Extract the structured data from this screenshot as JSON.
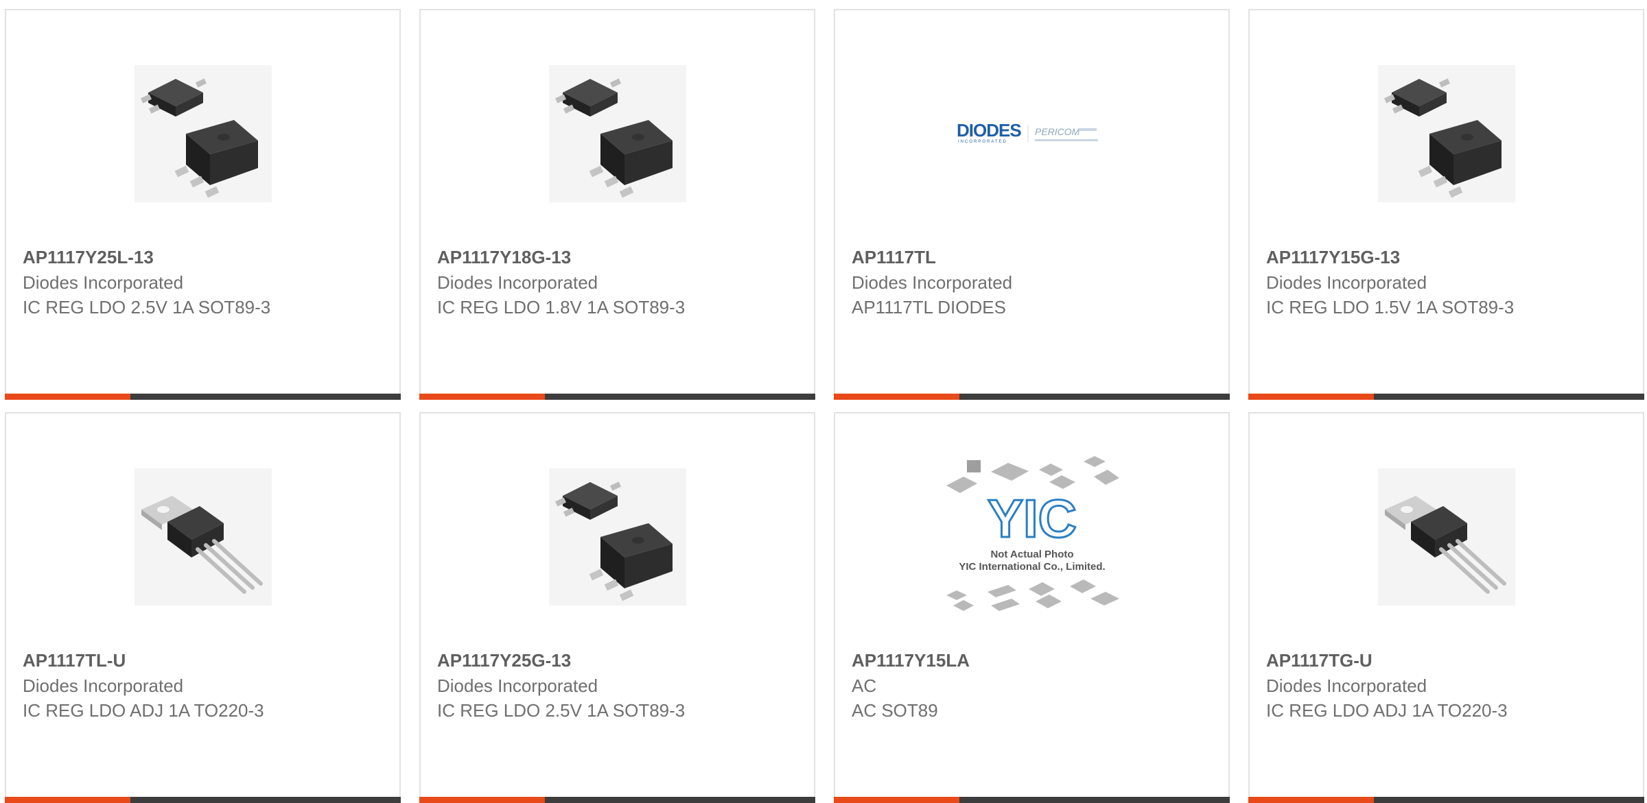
{
  "products": [
    {
      "part": "AP1117Y25L-13",
      "manufacturer": "Diodes Incorporated",
      "description": "IC REG LDO 2.5V 1A SOT89-3",
      "image": "sot89-package-icon"
    },
    {
      "part": "AP1117Y18G-13",
      "manufacturer": "Diodes Incorporated",
      "description": "IC REG LDO 1.8V 1A SOT89-3",
      "image": "sot89-package-icon"
    },
    {
      "part": "AP1117TL",
      "manufacturer": "Diodes Incorporated",
      "description": "AP1117TL DIODES",
      "image": "diodes-logo"
    },
    {
      "part": "AP1117Y15G-13",
      "manufacturer": "Diodes Incorporated",
      "description": "IC REG LDO 1.5V 1A SOT89-3",
      "image": "sot89-package-icon"
    },
    {
      "part": "AP1117TL-U",
      "manufacturer": "Diodes Incorporated",
      "description": "IC REG LDO ADJ 1A TO220-3",
      "image": "to220-package-icon"
    },
    {
      "part": "AP1117Y25G-13",
      "manufacturer": "Diodes Incorporated",
      "description": "IC REG LDO 2.5V 1A SOT89-3",
      "image": "sot89-package-icon"
    },
    {
      "part": "AP1117Y15LA",
      "manufacturer": "AC",
      "description": "AC SOT89",
      "image": "not-actual-photo-placeholder"
    },
    {
      "part": "AP1117TG-U",
      "manufacturer": "Diodes Incorporated",
      "description": "IC REG LDO ADJ 1A TO220-3",
      "image": "to220-package-icon"
    }
  ],
  "logos": {
    "diodes_text": "DIODES",
    "diodes_sub": "INCORPORATED",
    "pericom_text": "PERICOM",
    "placeholder_brand": "YIC",
    "placeholder_line1": "Not Actual Photo",
    "placeholder_line2": "YIC International Co., Limited."
  },
  "colors": {
    "accent_orange": "#e84a1a",
    "accent_dark": "#3d3d3d",
    "card_border": "#e2e2e2",
    "text_part": "#5f5f5f",
    "text_meta": "#6f6f6f",
    "diodes_blue": "#1f5fa8"
  }
}
